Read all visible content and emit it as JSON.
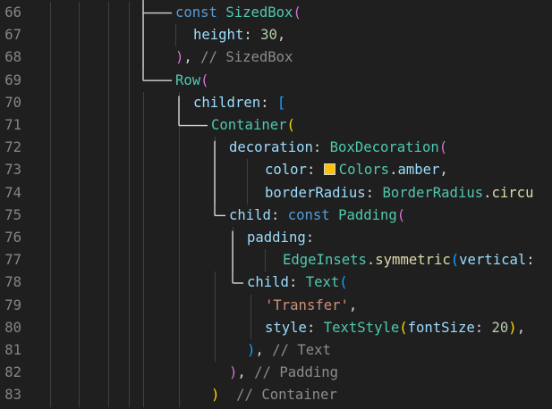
{
  "colors": {
    "background": "#1f1f1f",
    "line_number": "#858585",
    "keyword": "#569cd6",
    "type": "#4ec9b0",
    "property": "#9cdcfe",
    "punctuation": "#d4d4d4",
    "number": "#b5cea8",
    "string": "#ce9178",
    "comment": "#8c8c8c",
    "method": "#dcdcaa",
    "bracket_gold": "#ffd700",
    "bracket_pink": "#da70d6",
    "bracket_blue": "#179fff",
    "amber_swatch": "#ffc107"
  },
  "lines": [
    {
      "number": "66",
      "tokens": [
        {
          "text": "const",
          "kind": "keyword"
        },
        {
          "text": " ",
          "kind": "punctuation"
        },
        {
          "text": "SizedBox",
          "kind": "type"
        },
        {
          "text": "(",
          "kind": "bracket_pink"
        }
      ]
    },
    {
      "number": "67",
      "tokens": [
        {
          "text": "height",
          "kind": "property"
        },
        {
          "text": ": ",
          "kind": "punctuation"
        },
        {
          "text": "30",
          "kind": "number"
        },
        {
          "text": ",",
          "kind": "punctuation"
        }
      ]
    },
    {
      "number": "68",
      "tokens": [
        {
          "text": ")",
          "kind": "bracket_pink"
        },
        {
          "text": ", ",
          "kind": "punctuation"
        },
        {
          "text": "// SizedBox",
          "kind": "comment"
        }
      ]
    },
    {
      "number": "69",
      "tokens": [
        {
          "text": "Row",
          "kind": "type"
        },
        {
          "text": "(",
          "kind": "bracket_pink"
        }
      ]
    },
    {
      "number": "70",
      "tokens": [
        {
          "text": "children",
          "kind": "property"
        },
        {
          "text": ": ",
          "kind": "punctuation"
        },
        {
          "text": "[",
          "kind": "bracket_blue"
        }
      ]
    },
    {
      "number": "71",
      "tokens": [
        {
          "text": "Container",
          "kind": "type"
        },
        {
          "text": "(",
          "kind": "bracket_gold"
        }
      ]
    },
    {
      "number": "72",
      "tokens": [
        {
          "text": "decoration",
          "kind": "property"
        },
        {
          "text": ": ",
          "kind": "punctuation"
        },
        {
          "text": "BoxDecoration",
          "kind": "type"
        },
        {
          "text": "(",
          "kind": "bracket_pink"
        }
      ]
    },
    {
      "number": "73",
      "tokens": [
        {
          "text": "color",
          "kind": "property"
        },
        {
          "text": ": ",
          "kind": "punctuation"
        },
        {
          "text": "",
          "kind": "swatch"
        },
        {
          "text": "Colors",
          "kind": "type"
        },
        {
          "text": ".",
          "kind": "punctuation"
        },
        {
          "text": "amber",
          "kind": "property"
        },
        {
          "text": ",",
          "kind": "punctuation"
        }
      ]
    },
    {
      "number": "74",
      "tokens": [
        {
          "text": "borderRadius",
          "kind": "property"
        },
        {
          "text": ": ",
          "kind": "punctuation"
        },
        {
          "text": "BorderRadius",
          "kind": "type"
        },
        {
          "text": ".",
          "kind": "punctuation"
        },
        {
          "text": "circu",
          "kind": "method"
        }
      ]
    },
    {
      "number": "75",
      "tokens": [
        {
          "text": "child",
          "kind": "property"
        },
        {
          "text": ": ",
          "kind": "punctuation"
        },
        {
          "text": "const",
          "kind": "keyword"
        },
        {
          "text": " ",
          "kind": "punctuation"
        },
        {
          "text": "Padding",
          "kind": "type"
        },
        {
          "text": "(",
          "kind": "bracket_pink"
        }
      ]
    },
    {
      "number": "76",
      "tokens": [
        {
          "text": "padding",
          "kind": "property"
        },
        {
          "text": ":",
          "kind": "punctuation"
        }
      ]
    },
    {
      "number": "77",
      "tokens": [
        {
          "text": "EdgeInsets",
          "kind": "type"
        },
        {
          "text": ".",
          "kind": "punctuation"
        },
        {
          "text": "symmetric",
          "kind": "method"
        },
        {
          "text": "(",
          "kind": "bracket_blue"
        },
        {
          "text": "vertical",
          "kind": "property"
        },
        {
          "text": ":",
          "kind": "punctuation"
        }
      ]
    },
    {
      "number": "78",
      "tokens": [
        {
          "text": "child",
          "kind": "property"
        },
        {
          "text": ": ",
          "kind": "punctuation"
        },
        {
          "text": "Text",
          "kind": "type"
        },
        {
          "text": "(",
          "kind": "bracket_blue"
        }
      ]
    },
    {
      "number": "79",
      "tokens": [
        {
          "text": "'Transfer'",
          "kind": "string"
        },
        {
          "text": ",",
          "kind": "punctuation"
        }
      ]
    },
    {
      "number": "80",
      "tokens": [
        {
          "text": "style",
          "kind": "property"
        },
        {
          "text": ": ",
          "kind": "punctuation"
        },
        {
          "text": "TextStyle",
          "kind": "type"
        },
        {
          "text": "(",
          "kind": "bracket_gold"
        },
        {
          "text": "fontSize",
          "kind": "property"
        },
        {
          "text": ": ",
          "kind": "punctuation"
        },
        {
          "text": "20",
          "kind": "number"
        },
        {
          "text": ")",
          "kind": "bracket_gold"
        },
        {
          "text": ",",
          "kind": "punctuation"
        }
      ]
    },
    {
      "number": "81",
      "tokens": [
        {
          "text": ")",
          "kind": "bracket_blue"
        },
        {
          "text": ", ",
          "kind": "punctuation"
        },
        {
          "text": "// Text",
          "kind": "comment"
        }
      ]
    },
    {
      "number": "82",
      "tokens": [
        {
          "text": ")",
          "kind": "bracket_pink"
        },
        {
          "text": ", ",
          "kind": "punctuation"
        },
        {
          "text": "// Padding",
          "kind": "comment"
        }
      ]
    },
    {
      "number": "83",
      "tokens": [
        {
          "text": ")",
          "kind": "bracket_gold"
        },
        {
          "text": "  ",
          "kind": "punctuation"
        },
        {
          "text": "// Container",
          "kind": "comment"
        }
      ]
    }
  ]
}
